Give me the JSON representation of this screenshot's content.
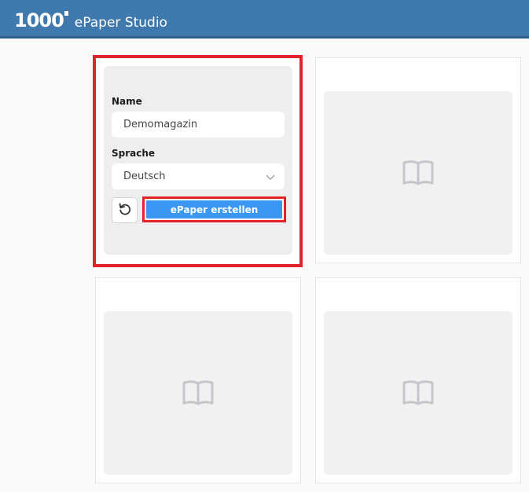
{
  "header": {
    "logo_text": "1000",
    "app_name": "ePaper Studio",
    "background_color": "#4079ad"
  },
  "create_form": {
    "name_label": "Name",
    "name_value": "Demomagazin",
    "language_label": "Sprache",
    "language_value": "Deutsch",
    "reset_icon": "reset-icon",
    "create_button_label": "ePaper erstellen",
    "create_button_color": "#3c97f3",
    "highlight_color": "#e0242a"
  },
  "placeholder_cards": [
    {
      "icon": "book-icon"
    },
    {
      "icon": "book-icon"
    },
    {
      "icon": "book-icon"
    }
  ]
}
